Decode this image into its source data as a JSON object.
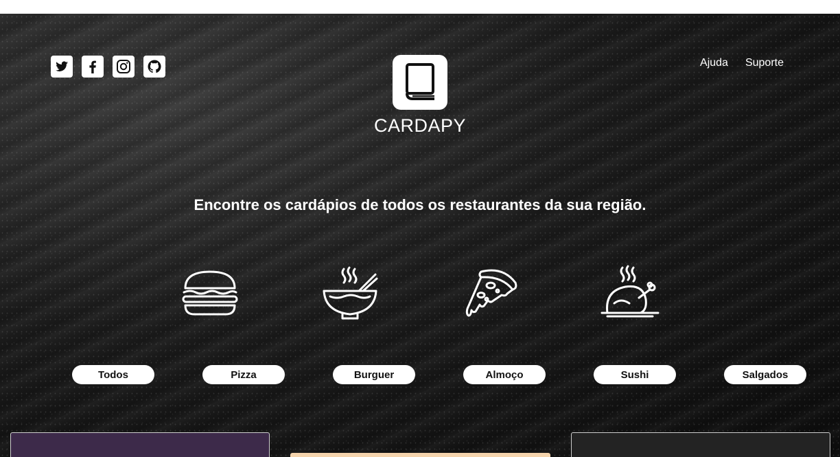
{
  "brand": {
    "name": "CARDAPY",
    "logo_icon": "book-icon"
  },
  "social": [
    {
      "name": "twitter-icon"
    },
    {
      "name": "facebook-icon"
    },
    {
      "name": "instagram-icon"
    },
    {
      "name": "github-icon"
    }
  ],
  "nav": {
    "help_label": "Ajuda",
    "support_label": "Suporte"
  },
  "tagline": "Encontre os cardápios de todos os restaurantes da sua região.",
  "food_icons": [
    "burger-icon",
    "noodle-bowl-icon",
    "pizza-slice-icon",
    "roast-chicken-icon"
  ],
  "categories": [
    "Todos",
    "Pizza",
    "Burguer",
    "Almoço",
    "Sushi",
    "Salgados"
  ],
  "colors": {
    "hero_bg": "#1c1c1c",
    "text": "#ffffff",
    "button_bg": "#ffffff",
    "card_purple": "#3d2a4a",
    "card_peach": "#f5d4ad",
    "card_dark": "#232323"
  }
}
